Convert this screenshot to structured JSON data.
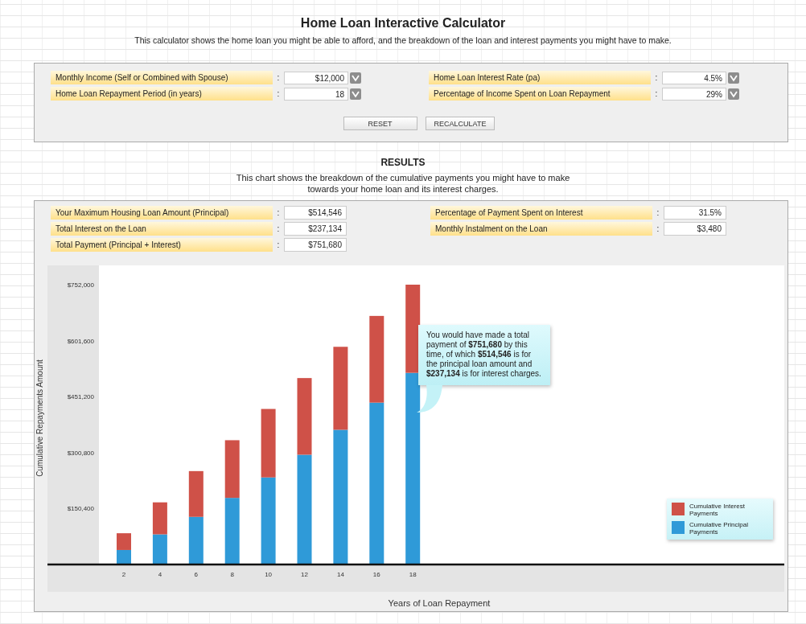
{
  "title": "Home Loan Interactive Calculator",
  "subtitle": "This calculator shows the home loan you might be able to afford, and the breakdown of the loan and interest payments you might have to make.",
  "inputs": [
    {
      "label": "Monthly Income (Self or Combined with Spouse)",
      "value": "$12,000"
    },
    {
      "label": "Home Loan Interest Rate (pa)",
      "value": "4.5%"
    },
    {
      "label": "Home Loan Repayment Period (in years)",
      "value": "18"
    },
    {
      "label": "Percentage of Income Spent on Loan Repayment",
      "value": "29%"
    }
  ],
  "separator": ":",
  "buttons": [
    "RESET",
    "RECALCULATE"
  ],
  "results_heading": "RESULTS",
  "results_text": "This chart shows the breakdown of the cumulative payments you might have to make towards your home loan and its interest charges.",
  "outputs": [
    {
      "label": "Your Maximum Housing Loan Amount (Principal)",
      "value": "$514,546"
    },
    {
      "label": "Percentage of Payment Spent on Interest",
      "value": "31.5%"
    },
    {
      "label": "Total Interest on the Loan",
      "value": "$237,134"
    },
    {
      "label": "Monthly Instalment on the Loan",
      "value": "$3,480"
    },
    {
      "label": "Total Payment (Principal + Interest)",
      "value": "$751,680"
    }
  ],
  "chart_data": {
    "type": "bar",
    "stacked": true,
    "xlabel": "Years of Loan Repayment",
    "ylabel": "Cumulative Repayments Amount",
    "categories": [
      "2",
      "4",
      "6",
      "8",
      "10",
      "12",
      "14",
      "16",
      "18"
    ],
    "series": [
      {
        "name": "Cumulative Principal Payments",
        "color": "#2f9ad8",
        "values": [
          39000,
          81000,
          128000,
          179000,
          234000,
          295000,
          362000,
          435000,
          515000
        ]
      },
      {
        "name": "Cumulative Interest Payments",
        "color": "#cf5148",
        "values": [
          45000,
          86000,
          123000,
          155000,
          184000,
          206000,
          223000,
          233000,
          237000
        ]
      }
    ],
    "ylim": [
      0,
      752000
    ],
    "yticks": [
      {
        "value": 150400,
        "label": "$150,400"
      },
      {
        "value": 300800,
        "label": "$300,800"
      },
      {
        "value": 451200,
        "label": "$451,200"
      },
      {
        "value": 601600,
        "label": "$601,600"
      },
      {
        "value": 752000,
        "label": "$752,000"
      }
    ]
  },
  "chart_tooltip": "You would have made  a total payment of **$751,680** by this time, of which **$514,546** is for the principal loan amount and **$237,134** is for interest charges."
}
